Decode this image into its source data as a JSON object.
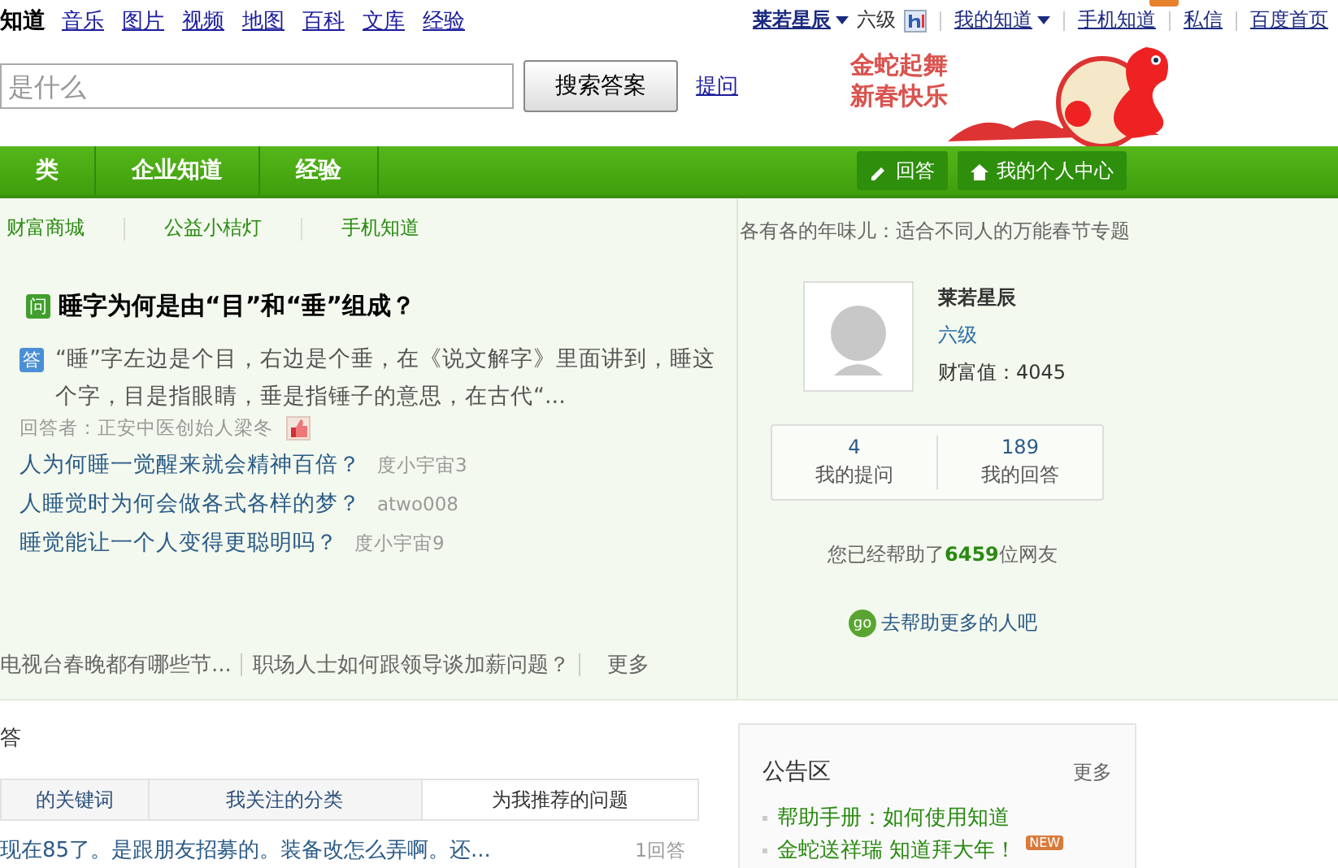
{
  "top_bar": {
    "logo": "知道",
    "links": [
      "音乐",
      "图片",
      "视频",
      "地图",
      "百科",
      "文库",
      "经验"
    ],
    "user": {
      "name": "莱若星辰",
      "level": "六级"
    },
    "menu": [
      {
        "label": "我的知道",
        "has_caret": true,
        "has_new": false
      },
      {
        "label": "手机知道",
        "has_caret": false,
        "has_new": true
      },
      {
        "label": "私信",
        "has_caret": false,
        "has_new": false
      },
      {
        "label": "百度首页",
        "has_caret": false,
        "has_new": false
      }
    ]
  },
  "search": {
    "placeholder": "是什么",
    "button": "搜索答案",
    "ask_link": "提问"
  },
  "banner": {
    "lines": [
      "金蛇起舞",
      "新春快乐"
    ]
  },
  "nav": {
    "tabs": [
      "类",
      "企业知道",
      "经验"
    ],
    "buttons": [
      {
        "label": "回答"
      },
      {
        "label": "我的个人中心"
      }
    ]
  },
  "feature": {
    "sub_links": [
      "财富商城",
      "公益小桔灯",
      "手机知道"
    ],
    "question": {
      "badge": "问",
      "title": "睡字为何是由“目”和“垂”组成？"
    },
    "answer": {
      "badge": "答",
      "text": "“睡”字左边是个目，右边是个垂，在《说文解字》里面讲到，睡这个字，目是指眼睛，垂是指锤子的意思，在古代“...",
      "answerer": "回答者：正安中医创始人梁冬"
    },
    "related": [
      {
        "title": "人为何睡一觉醒来就会精神百倍？",
        "author": "度小宇宙3"
      },
      {
        "title": "人睡觉时为何会做各式各样的梦？",
        "author": "atwo008"
      },
      {
        "title": "睡觉能让一个人变得更聪明吗？",
        "author": "度小宇宙9"
      }
    ],
    "hot": [
      "电视台春晚都有哪些节...",
      "职场人士如何跟领导谈加薪问题？"
    ],
    "more": "更多"
  },
  "profile": {
    "topic": "各有各的年味儿：适合不同人的万能春节专题",
    "name": "莱若星辰",
    "level": "六级",
    "wealth": "财富值：4045",
    "stats": [
      {
        "value": "4",
        "label": "我的提问"
      },
      {
        "value": "189",
        "label": "我的回答"
      }
    ],
    "helped": "您已经帮助了**6459**位网友",
    "go_badge": "go",
    "go_label": "去帮助更多的人吧"
  },
  "lower": {
    "heading": "答",
    "tabs": [
      {
        "label": "的关键词",
        "selected": false
      },
      {
        "label": "我关注的分类",
        "selected": false
      },
      {
        "label": "为我推荐的问题",
        "selected": true
      }
    ],
    "questions": [
      {
        "title": "现在85了。是跟朋友招募的。装备改怎么弄啊。还...",
        "count": "1回答"
      }
    ]
  },
  "notice": {
    "title": "公告区",
    "more": "更多",
    "items": [
      {
        "text": "帮助手册：如何使用知道"
      },
      {
        "text": "金蛇送祥瑞 知道拜大年！",
        "badge": "NEW"
      }
    ]
  }
}
